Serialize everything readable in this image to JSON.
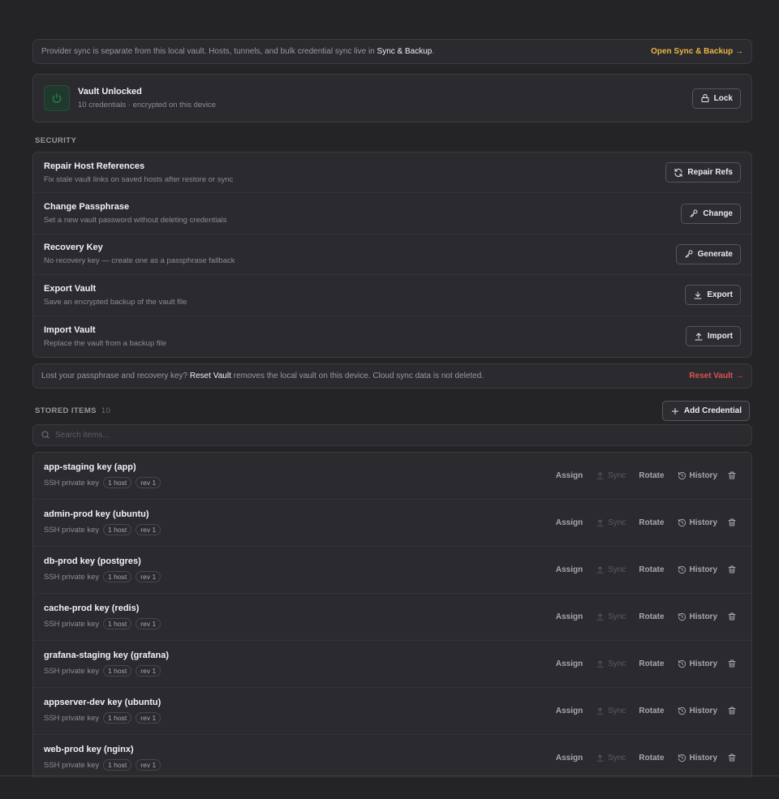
{
  "sync_notice": {
    "text_before": "Provider sync is separate from this local vault. Hosts, tunnels, and bulk credential sync live in ",
    "link_text": "Sync & Backup",
    "text_after": ".",
    "action": "Open Sync & Backup →"
  },
  "vault": {
    "title": "Vault Unlocked",
    "subtitle": "10 credentials · encrypted on this device",
    "lock_label": "Lock",
    "icon": "power-icon",
    "accent_color": "#1f3a2c"
  },
  "security": {
    "label": "SECURITY",
    "rows": [
      {
        "title": "Repair Host References",
        "subtitle": "Fix stale vault links on saved hosts after restore or sync",
        "button": "Repair Refs",
        "icon": "refresh-icon"
      },
      {
        "title": "Change Passphrase",
        "subtitle": "Set a new vault password without deleting credentials",
        "button": "Change",
        "icon": "key-icon"
      },
      {
        "title": "Recovery Key",
        "subtitle": "No recovery key — create one as a passphrase fallback",
        "button": "Generate",
        "icon": "key-icon"
      },
      {
        "title": "Export Vault",
        "subtitle": "Save an encrypted backup of the vault file",
        "button": "Export",
        "icon": "download-icon"
      },
      {
        "title": "Import Vault",
        "subtitle": "Replace the vault from a backup file",
        "button": "Import",
        "icon": "upload-icon"
      }
    ]
  },
  "reset_notice": {
    "text_before": "Lost your passphrase and recovery key? ",
    "link_text": "Reset Vault",
    "text_after": " removes the local vault on this device. Cloud sync data is not deleted.",
    "action": "Reset Vault →",
    "action_color": "#e0514f"
  },
  "stored": {
    "label": "STORED ITEMS",
    "count": "10",
    "add_label": "Add Credential",
    "search_placeholder": "Search items...",
    "actions": {
      "assign": "Assign",
      "sync": "Sync",
      "rotate": "Rotate",
      "history": "History"
    },
    "items": [
      {
        "name": "app-staging key (app)",
        "type": "SSH private key",
        "hosts": "1 host",
        "rev": "rev 1"
      },
      {
        "name": "admin-prod key (ubuntu)",
        "type": "SSH private key",
        "hosts": "1 host",
        "rev": "rev 1"
      },
      {
        "name": "db-prod key (postgres)",
        "type": "SSH private key",
        "hosts": "1 host",
        "rev": "rev 1"
      },
      {
        "name": "cache-prod key (redis)",
        "type": "SSH private key",
        "hosts": "1 host",
        "rev": "rev 1"
      },
      {
        "name": "grafana-staging key (grafana)",
        "type": "SSH private key",
        "hosts": "1 host",
        "rev": "rev 1"
      },
      {
        "name": "appserver-dev key (ubuntu)",
        "type": "SSH private key",
        "hosts": "1 host",
        "rev": "rev 1"
      },
      {
        "name": "web-prod key (nginx)",
        "type": "SSH private key",
        "hosts": "1 host",
        "rev": "rev 1"
      }
    ]
  }
}
